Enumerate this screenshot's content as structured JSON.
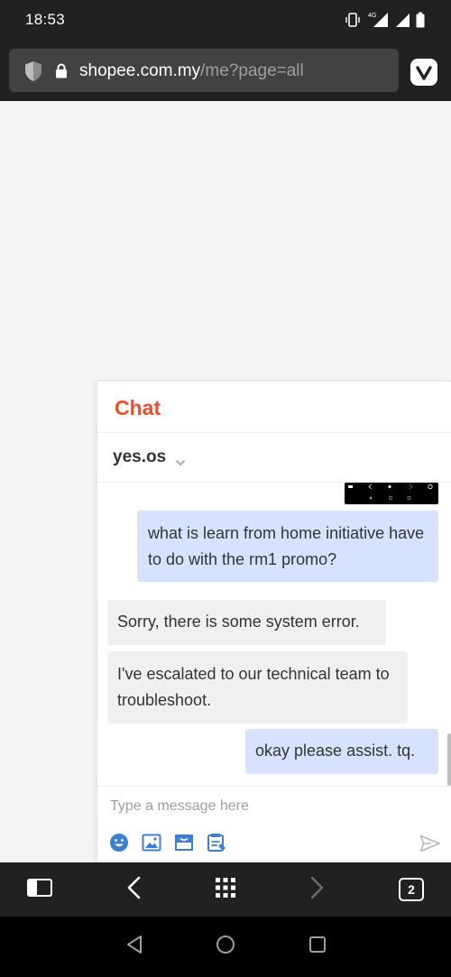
{
  "status_bar": {
    "time": "18:53",
    "network_label": "4G"
  },
  "browser": {
    "url_domain": "shopee.com.my",
    "url_path": "/me?page=all",
    "tab_count": "2"
  },
  "chat": {
    "title": "Chat",
    "contact_name": "yes.os",
    "messages": [
      {
        "direction": "outgoing",
        "text": "what is learn from home initiative have to do with the rm1 promo?"
      },
      {
        "direction": "incoming",
        "text": "Sorry, there is some system error."
      },
      {
        "direction": "incoming",
        "text": "I've escalated to our technical team to troubleshoot."
      },
      {
        "direction": "outgoing",
        "text": "okay please assist. tq."
      }
    ],
    "input_placeholder": "Type a message here",
    "input_value": "",
    "toolbar_icons": [
      "emoji-icon",
      "image-icon",
      "product-icon",
      "order-icon"
    ],
    "send_icon": "send-icon"
  },
  "colors": {
    "brand": "#ee4d2d",
    "outgoing_bubble": "#d7e3fe",
    "incoming_bubble": "#f0f0f0",
    "browser_chrome": "#212121"
  }
}
